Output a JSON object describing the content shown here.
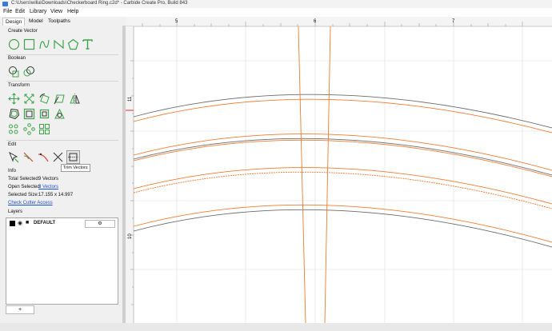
{
  "window": {
    "title": "C:\\Users\\willa\\Downloads\\Checkerboard Ring.c2d* - Carbide Create Pro, Build 843"
  },
  "menu": {
    "items": [
      "File",
      "Edit",
      "Library",
      "View",
      "Help"
    ]
  },
  "tabs": {
    "items": [
      "Design",
      "Model",
      "Toolpaths"
    ]
  },
  "sections": {
    "create_vector": "Create Vector",
    "boolean": "Boolean",
    "transform": "Transform",
    "edit": "Edit",
    "info": "Info",
    "layers": "Layers"
  },
  "tooltip": "Trim Vectors",
  "info": {
    "total_selected_label": "Total Selected:",
    "total_selected_value": "9 Vectors",
    "open_selected_label": "Open Selected:",
    "open_selected_value": "3 Vectors",
    "selected_size_label": "Selected Size:",
    "selected_size_value": "17.155 x 14.997",
    "check_cutter_link": "Check Cutter Access"
  },
  "layers": {
    "items": [
      {
        "name": "DEFAULT",
        "color": "#000000"
      }
    ],
    "add_button": "+"
  },
  "ruler": {
    "top_ticks": [
      "5",
      "6",
      "7"
    ],
    "left_ticks": [
      "11",
      "10"
    ]
  },
  "colors": {
    "selected_vector": "#f07a2e",
    "vector": "#6a6a6a",
    "grid": "#dddddd",
    "accent_green": "#3ea34a"
  },
  "icons": {
    "create_vector": [
      "circle-icon",
      "rectangle-icon",
      "curve-icon",
      "polyline-icon",
      "polygon-icon",
      "text-icon"
    ],
    "boolean": [
      "union-icon",
      "subtract-icon"
    ],
    "transform": [
      "move-icon",
      "scale-icon",
      "rotate-icon",
      "skew-icon",
      "mirror-icon",
      "offset-icon",
      "inset-icon",
      "align-icon",
      "array-icon",
      "circular-array-icon",
      "grid-array-icon"
    ],
    "edit": [
      "node-edit-icon",
      "fillet-icon",
      "join-icon",
      "trim-icon",
      "trim-vectors-icon"
    ]
  }
}
